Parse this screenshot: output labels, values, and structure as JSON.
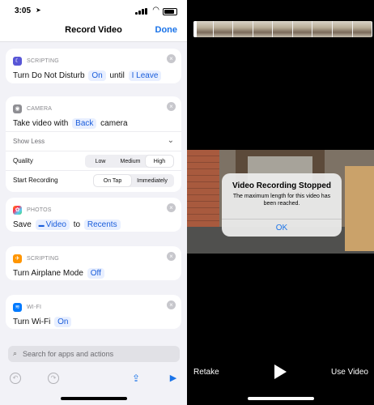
{
  "status_bar": {
    "time": "3:05",
    "location_arrow": "location-arrow-icon"
  },
  "navbar": {
    "title": "Record Video",
    "done_label": "Done"
  },
  "actions": [
    {
      "category": "SCRIPTING",
      "icon": "moon-icon",
      "icon_glyph": "☾",
      "parts": [
        "Turn Do Not Disturb",
        "On",
        "until",
        "I Leave"
      ]
    },
    {
      "category": "CAMERA",
      "icon": "camera-icon",
      "icon_glyph": "◉",
      "parts": [
        "Take video with",
        "Back",
        "camera"
      ],
      "show_less_label": "Show Less",
      "quality_label": "Quality",
      "quality_options": [
        "Low",
        "Medium",
        "High"
      ],
      "quality_selected": "High",
      "start_label": "Start Recording",
      "start_options": [
        "On Tap",
        "Immediately"
      ],
      "start_selected": "On Tap"
    },
    {
      "category": "PHOTOS",
      "icon": "photos-icon",
      "icon_glyph": "✿",
      "parts": [
        "Save",
        "Video",
        "to",
        "Recents"
      ],
      "video_icon": "video-file-icon"
    },
    {
      "category": "SCRIPTING",
      "icon": "airplane-icon",
      "icon_glyph": "✈",
      "parts": [
        "Turn Airplane Mode",
        "Off"
      ]
    },
    {
      "category": "WI-FI",
      "icon": "wifi-icon",
      "icon_glyph": "≋",
      "parts": [
        "Turn Wi-Fi",
        "On"
      ]
    }
  ],
  "search": {
    "placeholder": "Search for apps and actions"
  },
  "camera": {
    "alert_title": "Video Recording Stopped",
    "alert_message": "The maximum length for this video has been reached.",
    "alert_ok": "OK",
    "retake_label": "Retake",
    "use_video_label": "Use Video"
  },
  "colors": {
    "accent": "#1a73e8",
    "chip_bg": "#e8efff",
    "background": "#f2f2f7"
  }
}
